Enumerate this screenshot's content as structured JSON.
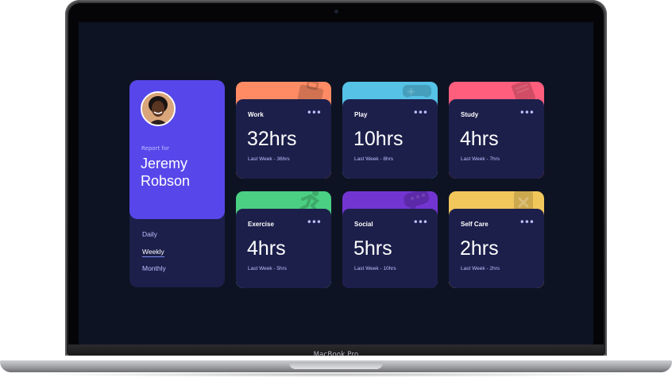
{
  "device": {
    "brand_label": "MacBook Pro"
  },
  "profile": {
    "report_for": "Report for",
    "name": "Jeremy Robson",
    "periods": [
      "Daily",
      "Weekly",
      "Monthly"
    ],
    "active_period": "Weekly"
  },
  "cards": [
    {
      "title": "Work",
      "current": "32hrs",
      "previous": "Last Week - 36hrs",
      "color": "#ff8b64",
      "icon": "briefcase-icon"
    },
    {
      "title": "Play",
      "current": "10hrs",
      "previous": "Last Week - 8hrs",
      "color": "#55c2e6",
      "icon": "gamepad-icon"
    },
    {
      "title": "Study",
      "current": "4hrs",
      "previous": "Last Week - 7hrs",
      "color": "#ff5e7d",
      "icon": "book-icon"
    },
    {
      "title": "Exercise",
      "current": "4hrs",
      "previous": "Last Week - 5hrs",
      "color": "#4bcf82",
      "icon": "runner-icon"
    },
    {
      "title": "Social",
      "current": "5hrs",
      "previous": "Last Week - 10hrs",
      "color": "#7335d2",
      "icon": "chat-icon"
    },
    {
      "title": "Self Care",
      "current": "2hrs",
      "previous": "Last Week - 2hrs",
      "color": "#f1c75b",
      "icon": "heart-icon"
    }
  ],
  "colors": {
    "screen_bg": "#0e1323",
    "card_bg": "#1c1f4a",
    "profile_bg": "#5747ea",
    "muted_text": "#bbc0ff"
  }
}
